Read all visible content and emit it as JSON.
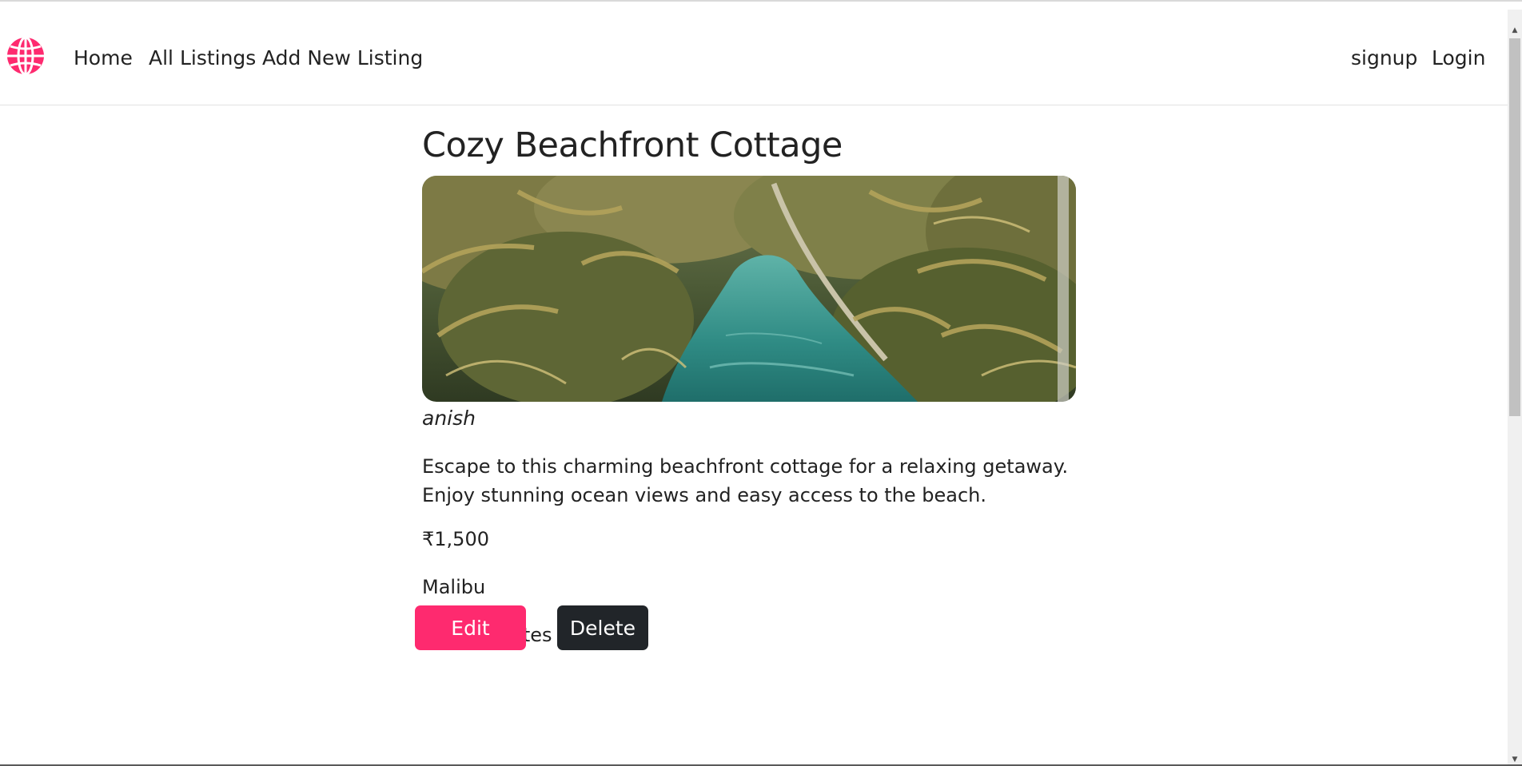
{
  "nav": {
    "logo_icon": "globe-icon",
    "links": [
      "Home",
      "All Listings",
      "Add New Listing"
    ],
    "auth": {
      "signup": "signup",
      "login": "Login"
    }
  },
  "listing": {
    "title": "Cozy Beachfront Cottage",
    "image_icon": "tropical-river-palm-photo",
    "owner": "anish",
    "description": "Escape to this charming beachfront cottage for a relaxing getaway. Enjoy stunning ocean views and easy access to the beach.",
    "price": "₹1,500",
    "location": "Malibu",
    "country": "United States"
  },
  "actions": {
    "edit": "Edit",
    "delete": "Delete"
  },
  "colors": {
    "accent": "#fe2a6f",
    "dark_button": "#212529",
    "text": "#222222"
  }
}
